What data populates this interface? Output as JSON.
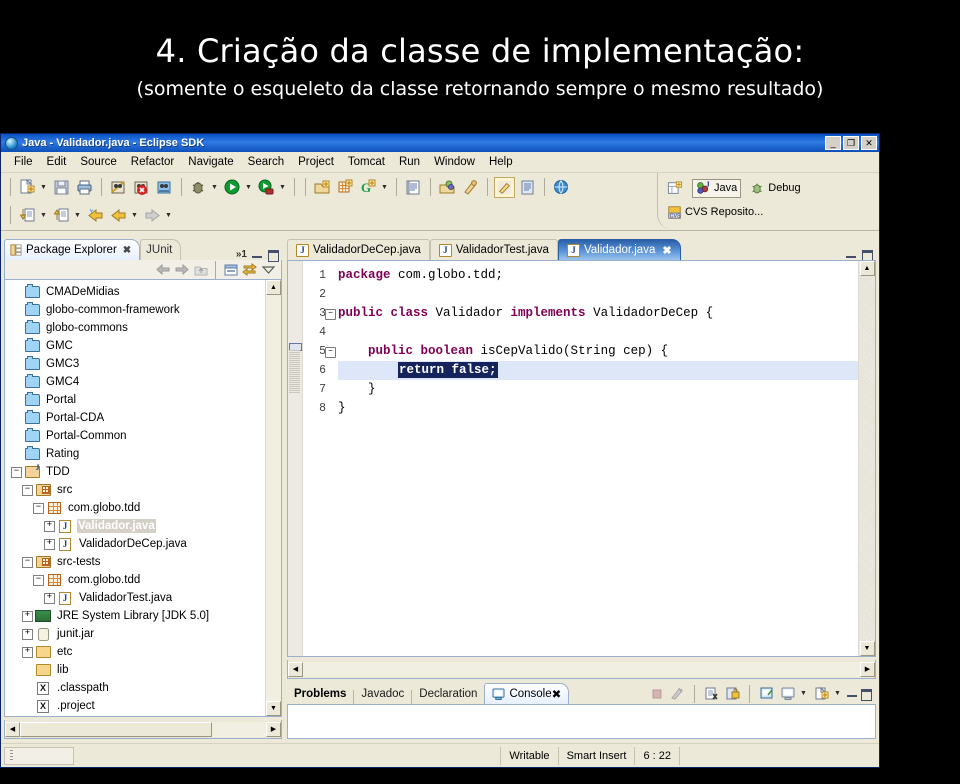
{
  "slide": {
    "title": "4. Criação da classe de implementação:",
    "subtitle": "(somente o esqueleto da classe retornando sempre o mesmo resultado)"
  },
  "window": {
    "title": "Java - Validador.java - Eclipse SDK",
    "icon": "eclipse-icon",
    "buttons": {
      "minimize": "_",
      "restore": "❐",
      "close": "✕"
    }
  },
  "menu": {
    "items": [
      "File",
      "Edit",
      "Source",
      "Refactor",
      "Navigate",
      "Search",
      "Project",
      "Tomcat",
      "Run",
      "Window",
      "Help"
    ]
  },
  "toolbar": {
    "row1": [
      "new-java-file-icon",
      "new-dropdown-arrow",
      "save-icon",
      "print-icon",
      "separator",
      "build-all-icon",
      "build-error-icon",
      "build-project-icon",
      "separator",
      "debug-icon",
      "debug-dropdown-arrow",
      "run-icon",
      "run-dropdown-arrow",
      "run-external-icon",
      "run-external-dropdown-arrow",
      "separator",
      "new-package-icon",
      "new-class-icon",
      "new-interface-icon",
      "new-type-dropdown-arrow",
      "separator",
      "open-type-icon",
      "separator",
      "search-icon",
      "quickfix-icon",
      "separator",
      "toggle-mark-occurrences-icon",
      "toggle-comment-icon",
      "separator",
      "open-web-browser-icon"
    ],
    "row2": [
      "previous-annotation-icon",
      "previous-dropdown-arrow",
      "next-annotation-icon",
      "next-dropdown-arrow",
      "last-edit-location-icon",
      "back-icon",
      "back-dropdown-arrow",
      "forward-icon",
      "forward-dropdown-arrow"
    ]
  },
  "perspective": {
    "open_perspective_icon": "open-perspective-icon",
    "items": [
      {
        "label": "Java",
        "icon": "java-perspective-icon",
        "active": true
      },
      {
        "label": "Debug",
        "icon": "debug-perspective-icon",
        "active": false
      },
      {
        "label": "CVS Reposito...",
        "icon": "cvs-perspective-icon",
        "active": false
      }
    ]
  },
  "package_explorer": {
    "tabs": [
      {
        "label": "Package Explorer",
        "icon": "package-explorer-icon",
        "active": true,
        "closable": true
      },
      {
        "label": "JUnit",
        "icon": "junit-icon",
        "active": false,
        "closable": false
      }
    ],
    "overflow_indicator": "»1",
    "view_buttons": [
      "minimize-view-button",
      "maximize-view-button"
    ],
    "local_toolbar": [
      "back-icon",
      "forward-icon",
      "up-icon",
      "collapse-all-icon",
      "link-with-editor-icon",
      "view-menu-icon"
    ],
    "tree": [
      {
        "label": "CMADeMidias",
        "indent": 0,
        "expander": "line",
        "icon": "project-closed-icon",
        "selected": false
      },
      {
        "label": "globo-common-framework",
        "indent": 0,
        "expander": "line",
        "icon": "project-closed-icon",
        "selected": false
      },
      {
        "label": "globo-commons",
        "indent": 0,
        "expander": "line",
        "icon": "project-closed-icon",
        "selected": false
      },
      {
        "label": "GMC",
        "indent": 0,
        "expander": "line",
        "icon": "project-closed-icon",
        "selected": false
      },
      {
        "label": "GMC3",
        "indent": 0,
        "expander": "line",
        "icon": "project-closed-icon",
        "selected": false
      },
      {
        "label": "GMC4",
        "indent": 0,
        "expander": "line",
        "icon": "project-closed-icon",
        "selected": false
      },
      {
        "label": "Portal",
        "indent": 0,
        "expander": "line",
        "icon": "project-closed-icon",
        "selected": false
      },
      {
        "label": "Portal-CDA",
        "indent": 0,
        "expander": "line",
        "icon": "project-closed-icon",
        "selected": false
      },
      {
        "label": "Portal-Common",
        "indent": 0,
        "expander": "line",
        "icon": "project-closed-icon",
        "selected": false
      },
      {
        "label": "Rating",
        "indent": 0,
        "expander": "line",
        "icon": "project-closed-icon",
        "selected": false
      },
      {
        "label": "TDD",
        "indent": 0,
        "expander": "minus",
        "icon": "java-project-icon",
        "selected": false
      },
      {
        "label": "src",
        "indent": 1,
        "expander": "minus",
        "icon": "source-folder-icon",
        "selected": false
      },
      {
        "label": "com.globo.tdd",
        "indent": 2,
        "expander": "minus",
        "icon": "package-icon",
        "selected": false
      },
      {
        "label": "Validador.java",
        "indent": 3,
        "expander": "plus",
        "icon": "java-file-icon",
        "selected": true
      },
      {
        "label": "ValidadorDeCep.java",
        "indent": 3,
        "expander": "plus",
        "icon": "java-file-icon",
        "selected": false
      },
      {
        "label": "src-tests",
        "indent": 1,
        "expander": "minus",
        "icon": "source-folder-icon",
        "selected": false
      },
      {
        "label": "com.globo.tdd",
        "indent": 2,
        "expander": "minus",
        "icon": "package-icon",
        "selected": false
      },
      {
        "label": "ValidadorTest.java",
        "indent": 3,
        "expander": "plus",
        "icon": "java-file-icon",
        "selected": false
      },
      {
        "label": "JRE System Library [JDK 5.0]",
        "indent": 1,
        "expander": "plus",
        "icon": "jre-library-icon",
        "selected": false
      },
      {
        "label": "junit.jar",
        "indent": 1,
        "expander": "plus",
        "icon": "jar-icon",
        "selected": false
      },
      {
        "label": "etc",
        "indent": 1,
        "expander": "plus",
        "icon": "folder-icon",
        "selected": false
      },
      {
        "label": "lib",
        "indent": 1,
        "expander": "none",
        "icon": "folder-icon",
        "selected": false
      },
      {
        "label": ".classpath",
        "indent": 1,
        "expander": "line",
        "icon": "xml-file-icon",
        "selected": false
      },
      {
        "label": ".project",
        "indent": 1,
        "expander": "line",
        "icon": "xml-file-icon",
        "selected": false
      }
    ]
  },
  "editor": {
    "tabs": [
      {
        "label": "ValidadorDeCep.java",
        "active": false,
        "closable": false
      },
      {
        "label": "ValidadorTest.java",
        "active": false,
        "closable": false
      },
      {
        "label": "Validador.java",
        "active": true,
        "closable": true
      }
    ],
    "view_buttons": [
      "minimize-editor-button",
      "maximize-editor-button"
    ],
    "gutter": [
      "1",
      "2",
      "3",
      "4",
      "5",
      "6",
      "7",
      "8"
    ],
    "fold_lines": [
      "3",
      "5"
    ],
    "current_line": 6,
    "code_lines": [
      {
        "n": 1,
        "segments": [
          {
            "t": "package ",
            "k": true
          },
          {
            "t": "com.globo.tdd;",
            "k": false
          }
        ]
      },
      {
        "n": 2,
        "segments": [
          {
            "t": "",
            "k": false
          }
        ]
      },
      {
        "n": 3,
        "segments": [
          {
            "t": "public class ",
            "k": true
          },
          {
            "t": "Validador ",
            "k": false
          },
          {
            "t": "implements ",
            "k": true
          },
          {
            "t": "ValidadorDeCep {",
            "k": false
          }
        ]
      },
      {
        "n": 4,
        "segments": [
          {
            "t": "",
            "k": false
          }
        ]
      },
      {
        "n": 5,
        "segments": [
          {
            "t": "    ",
            "k": false
          },
          {
            "t": "public boolean ",
            "k": true
          },
          {
            "t": "isCepValido(String cep) {",
            "k": false
          }
        ]
      },
      {
        "n": 6,
        "segments": [
          {
            "t": "        ",
            "k": false
          },
          {
            "t": "return false;",
            "k": false,
            "sel": true
          }
        ]
      },
      {
        "n": 7,
        "segments": [
          {
            "t": "    }",
            "k": false
          }
        ]
      },
      {
        "n": 8,
        "segments": [
          {
            "t": "}",
            "k": false
          }
        ]
      }
    ]
  },
  "bottom_panel": {
    "tabs": [
      {
        "label": "Problems",
        "active": false,
        "bold": true,
        "icon": null,
        "closable": false
      },
      {
        "label": "Javadoc",
        "active": false,
        "bold": false,
        "icon": null,
        "closable": false
      },
      {
        "label": "Declaration",
        "active": false,
        "bold": false,
        "icon": null,
        "closable": false
      },
      {
        "label": "Console",
        "active": true,
        "bold": false,
        "icon": "console-icon",
        "closable": true
      }
    ],
    "toolbar": [
      "terminate-icon",
      "remove-all-terminated-icon",
      "separator",
      "clear-console-icon",
      "scroll-lock-icon",
      "separator",
      "pin-console-icon",
      "display-selected-console-icon",
      "display-console-dropdown-arrow",
      "open-console-icon",
      "open-console-dropdown-arrow",
      "restore-view-button",
      "maximize-view-button"
    ]
  },
  "status_bar": {
    "grip": "resize-grip",
    "writable": "Writable",
    "insert_mode": "Smart Insert",
    "cursor_position": "6 : 22"
  },
  "colors": {
    "title_bar_blue": "#0a51c4",
    "keyword_purple": "#7f0055",
    "selection_navy": "#14235c",
    "current_line": "#dde7f7",
    "chrome": "#ece9d8",
    "slide_bg": "#000000"
  }
}
